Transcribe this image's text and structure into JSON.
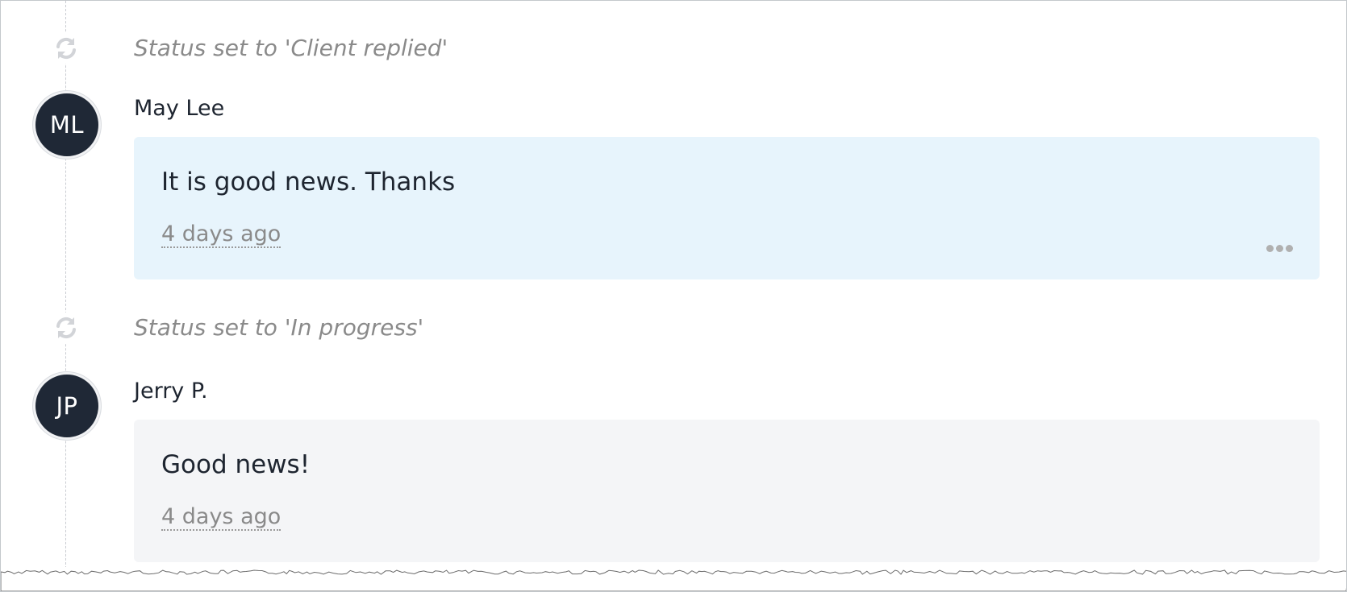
{
  "timeline": [
    {
      "kind": "status",
      "icon": "refresh-icon",
      "text": "Status set to 'Client replied'"
    },
    {
      "kind": "comment",
      "author": "May Lee",
      "initials": "ML",
      "body": "It is good news. Thanks",
      "timestamp": "4 days ago",
      "card_color": "#e7f4fc",
      "has_more_menu": true
    },
    {
      "kind": "status",
      "icon": "refresh-icon",
      "text": "Status set to 'In progress'"
    },
    {
      "kind": "comment",
      "author": "Jerry P.",
      "initials": "JP",
      "body": "Good news!",
      "timestamp": "4 days ago",
      "card_color": "#f4f5f7",
      "has_more_menu": false
    }
  ],
  "colors": {
    "avatar_bg": "#1f2836",
    "status_text": "#8a8a8a",
    "timeline_line": "#c9ccd1",
    "more_dots": "#b0b0b0"
  }
}
